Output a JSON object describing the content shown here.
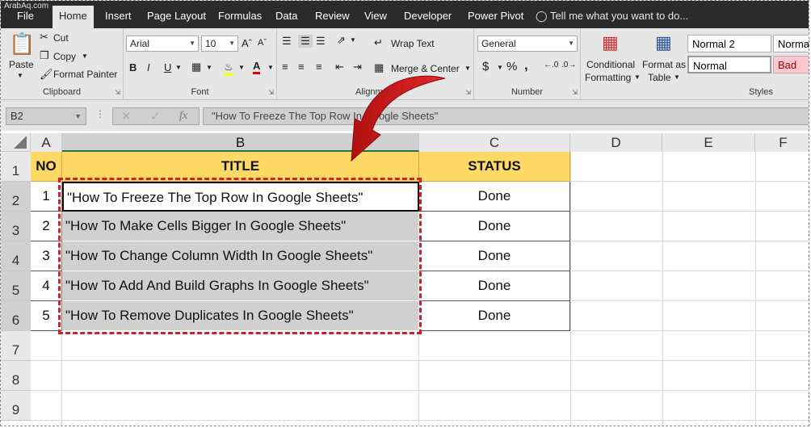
{
  "watermark": "ArabAq.com",
  "tabs": [
    "File",
    "Home",
    "Insert",
    "Page Layout",
    "Formulas",
    "Data",
    "Review",
    "View",
    "Developer",
    "Power Pivot"
  ],
  "tell_me": "Tell me what you want to do...",
  "clipboard": {
    "paste": "Paste",
    "cut": "Cut",
    "copy": "Copy",
    "format_painter": "Format Painter",
    "label": "Clipboard"
  },
  "font": {
    "name": "Arial",
    "size": "10",
    "label": "Font",
    "bold": "B",
    "italic": "I",
    "underline": "U"
  },
  "alignment": {
    "wrap_text": "Wrap Text",
    "merge_center": "Merge & Center",
    "label": "Alignment"
  },
  "number": {
    "format": "General",
    "currency": "$",
    "percent": "%",
    "comma": ",",
    "label": "Number"
  },
  "styles": {
    "conditional": "Conditional",
    "formatting": "Formatting",
    "format_as": "Format as",
    "table": "Table",
    "normal2": "Normal 2",
    "normal_partial": "Norma",
    "normal": "Normal",
    "bad": "Bad",
    "label": "Styles"
  },
  "formula_bar": {
    "name_box": "B2",
    "fx": "fx",
    "content": "\"How To Freeze The Top Row In Google Sheets\""
  },
  "columns": [
    "A",
    "B",
    "C",
    "D",
    "E",
    "F"
  ],
  "rows": [
    "1",
    "2",
    "3",
    "4",
    "5",
    "6",
    "7",
    "8",
    "9"
  ],
  "table": {
    "headers": {
      "no": "NO",
      "title": "TITLE",
      "status": "STATUS"
    },
    "rows": [
      {
        "no": "1",
        "title": "\"How To Freeze The Top Row In Google Sheets\"",
        "status": "Done"
      },
      {
        "no": "2",
        "title": "\"How To Make Cells Bigger In Google Sheets\"",
        "status": "Done"
      },
      {
        "no": "3",
        "title": "\"How To Change Column Width In Google Sheets\"",
        "status": "Done"
      },
      {
        "no": "4",
        "title": "\"How To Add And Build Graphs In Google Sheets\"",
        "status": "Done"
      },
      {
        "no": "5",
        "title": "\"How To Remove Duplicates In Google Sheets\"",
        "status": "Done"
      }
    ]
  },
  "colors": {
    "accent": "#217346",
    "header_fill": "#ffd966",
    "selection_fill": "#d0d0d0",
    "annotation": "#d0202a"
  }
}
